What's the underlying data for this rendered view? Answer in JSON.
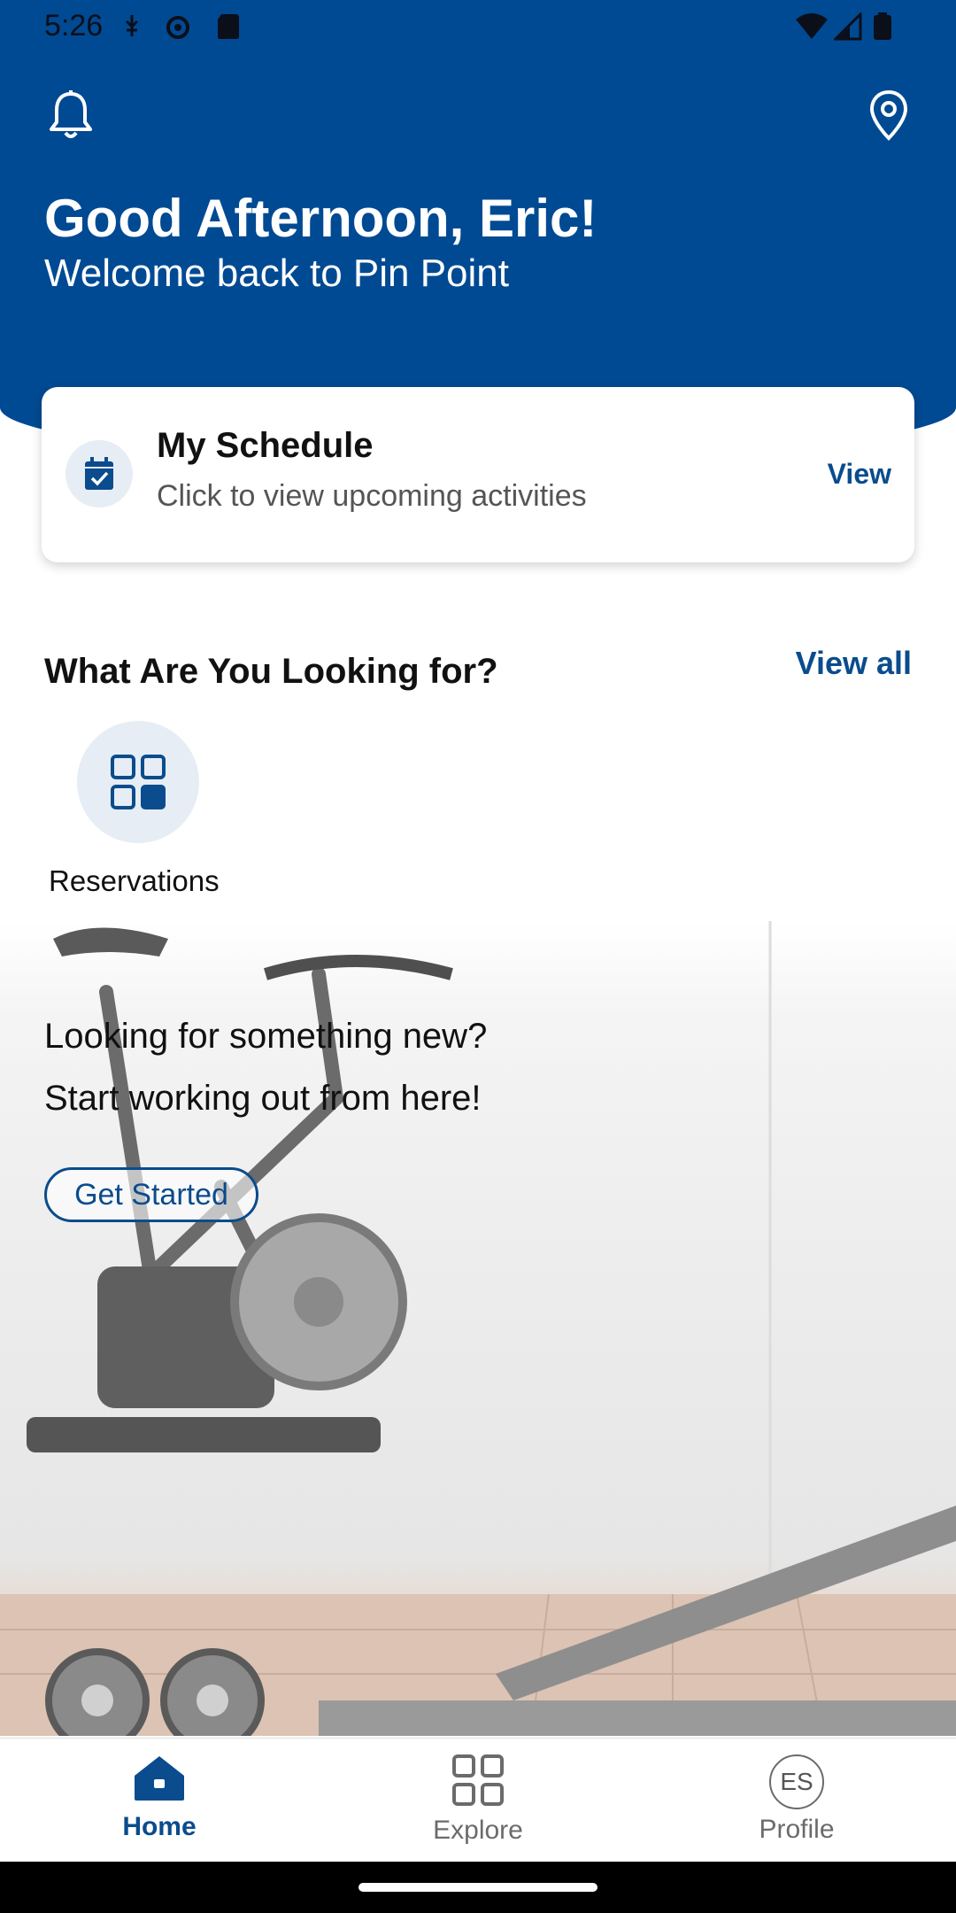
{
  "status_bar": {
    "time": "5:26"
  },
  "header": {
    "greeting": "Good Afternoon, Eric!",
    "subtitle": "Welcome back to Pin Point",
    "bg_color": "#004a93"
  },
  "schedule_card": {
    "title": "My Schedule",
    "subtitle": "Click to view upcoming activities",
    "view_label": "View"
  },
  "lookup_section": {
    "title": "What Are You Looking for?",
    "view_all_label": "View all",
    "items": [
      {
        "label": "Reservations",
        "icon": "grid-icon"
      }
    ]
  },
  "promo": {
    "line1": "Looking for something new?",
    "line2": "Start working out from here!",
    "cta_label": "Get Started"
  },
  "bottom_nav": {
    "items": [
      {
        "label": "Home",
        "icon": "home-icon",
        "active": true
      },
      {
        "label": "Explore",
        "icon": "grid-icon",
        "active": false
      },
      {
        "label": "Profile",
        "icon": "avatar-icon",
        "initials": "ES",
        "active": false
      }
    ]
  },
  "colors": {
    "accent": "#0a4c8d",
    "header": "#004a93"
  }
}
